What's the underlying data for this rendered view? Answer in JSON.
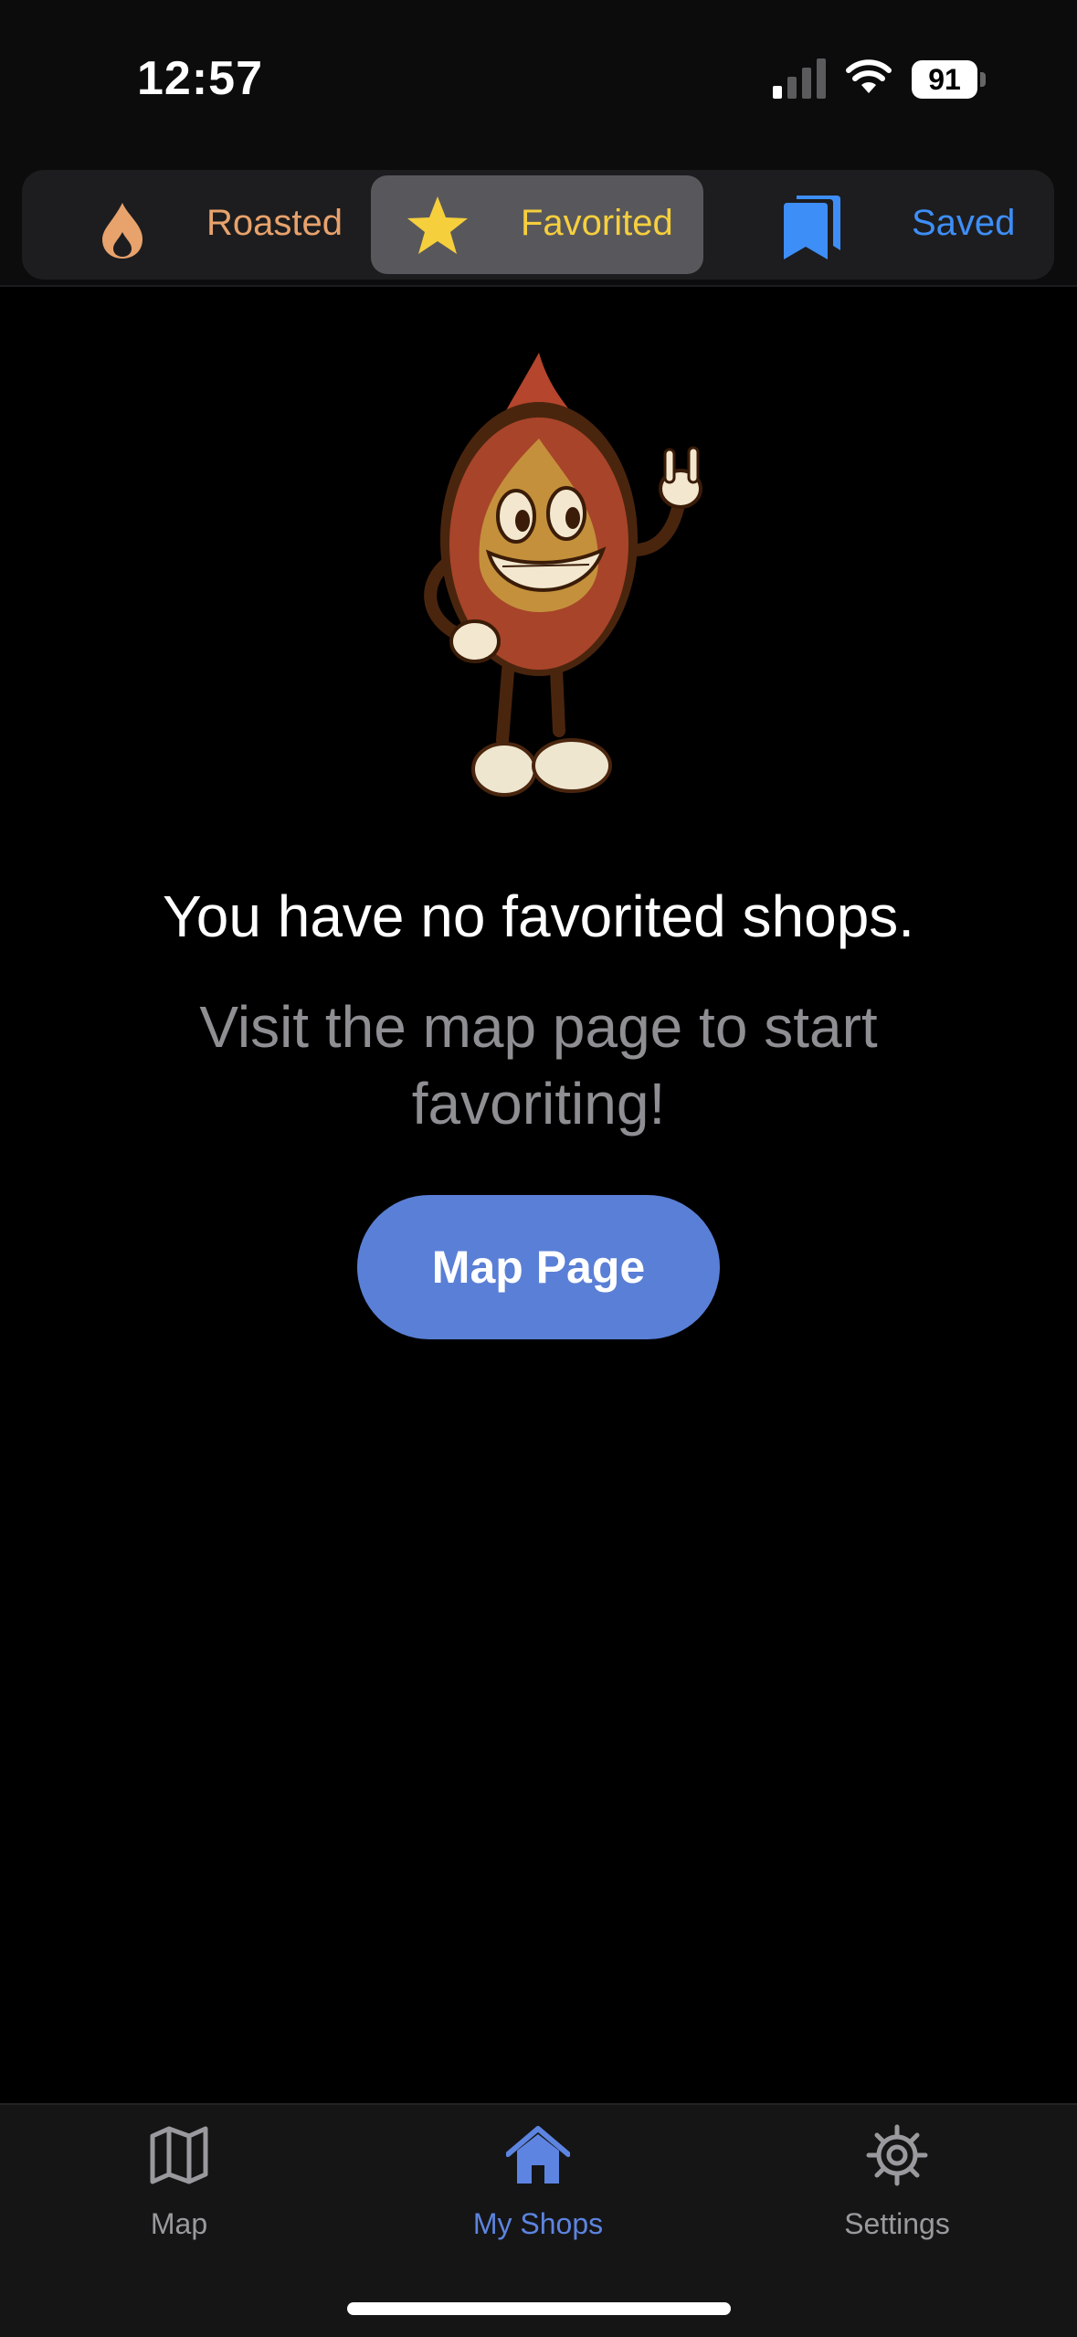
{
  "status_bar": {
    "time": "12:57",
    "battery": "91"
  },
  "segments": [
    {
      "label": "Roasted",
      "icon": "flame-icon",
      "color": "#e8a26c"
    },
    {
      "label": "Favorited",
      "icon": "star-icon",
      "color": "#f6cf3d",
      "selected": true
    },
    {
      "label": "Saved",
      "icon": "bookmarks-icon",
      "color": "#3e8ef7"
    }
  ],
  "empty_state": {
    "mascot": "coffee-bean-mascot",
    "title": "You have no favorited shops.",
    "subtitle": "Visit the map page to start favoriting!",
    "button_label": "Map Page"
  },
  "tab_bar": [
    {
      "label": "Map",
      "icon": "map-icon",
      "active": false
    },
    {
      "label": "My Shops",
      "icon": "house-icon",
      "active": true
    },
    {
      "label": "Settings",
      "icon": "gear-icon",
      "active": false
    }
  ],
  "colors": {
    "accent": "#5a7fd6",
    "active_tab": "#5d84e0",
    "inactive_tab": "#9a9a9e",
    "subtitle": "#8e8e93"
  }
}
